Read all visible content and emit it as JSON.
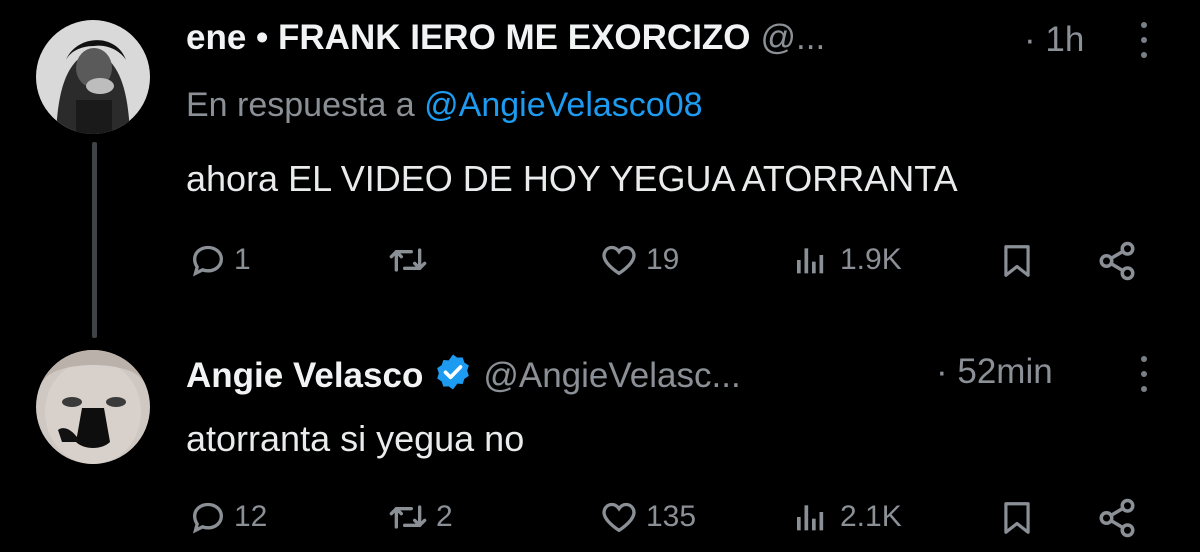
{
  "tweets": [
    {
      "display_name": "ene • FRANK IERO ME EXORCIZO",
      "handle": "@...",
      "time": "· 1h",
      "reply_prefix": "En respuesta a",
      "reply_mention": "@AngieVelasco08",
      "text": "ahora EL VIDEO DE HOY YEGUA ATORRANTA",
      "replies": "1",
      "retweets": "",
      "likes": "19",
      "views": "1.9K"
    },
    {
      "display_name": "Angie Velasco",
      "handle": "@AngieVelasc...",
      "time": "· 52min",
      "verified": true,
      "text": "atorranta si yegua no",
      "replies": "12",
      "retweets": "2",
      "likes": "135",
      "views": "2.1K"
    }
  ],
  "colors": {
    "background": "#000000",
    "text": "#e7e9ea",
    "muted": "#8b9096",
    "link": "#1d9bf0",
    "verified": "#1d9bf0"
  },
  "icons": [
    "reply-icon",
    "retweet-icon",
    "like-icon",
    "views-icon",
    "bookmark-icon",
    "share-icon",
    "more-icon",
    "verified-badge-icon"
  ]
}
